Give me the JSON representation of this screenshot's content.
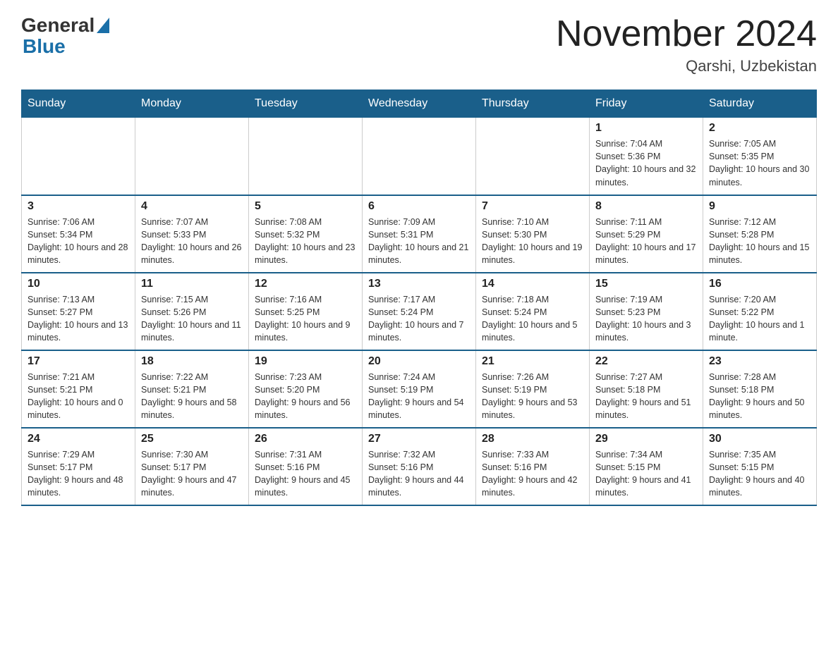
{
  "header": {
    "logo_general": "General",
    "logo_blue": "Blue",
    "title": "November 2024",
    "subtitle": "Qarshi, Uzbekistan"
  },
  "days_of_week": [
    "Sunday",
    "Monday",
    "Tuesday",
    "Wednesday",
    "Thursday",
    "Friday",
    "Saturday"
  ],
  "weeks": [
    [
      {
        "day": "",
        "info": ""
      },
      {
        "day": "",
        "info": ""
      },
      {
        "day": "",
        "info": ""
      },
      {
        "day": "",
        "info": ""
      },
      {
        "day": "",
        "info": ""
      },
      {
        "day": "1",
        "info": "Sunrise: 7:04 AM\nSunset: 5:36 PM\nDaylight: 10 hours and 32 minutes."
      },
      {
        "day": "2",
        "info": "Sunrise: 7:05 AM\nSunset: 5:35 PM\nDaylight: 10 hours and 30 minutes."
      }
    ],
    [
      {
        "day": "3",
        "info": "Sunrise: 7:06 AM\nSunset: 5:34 PM\nDaylight: 10 hours and 28 minutes."
      },
      {
        "day": "4",
        "info": "Sunrise: 7:07 AM\nSunset: 5:33 PM\nDaylight: 10 hours and 26 minutes."
      },
      {
        "day": "5",
        "info": "Sunrise: 7:08 AM\nSunset: 5:32 PM\nDaylight: 10 hours and 23 minutes."
      },
      {
        "day": "6",
        "info": "Sunrise: 7:09 AM\nSunset: 5:31 PM\nDaylight: 10 hours and 21 minutes."
      },
      {
        "day": "7",
        "info": "Sunrise: 7:10 AM\nSunset: 5:30 PM\nDaylight: 10 hours and 19 minutes."
      },
      {
        "day": "8",
        "info": "Sunrise: 7:11 AM\nSunset: 5:29 PM\nDaylight: 10 hours and 17 minutes."
      },
      {
        "day": "9",
        "info": "Sunrise: 7:12 AM\nSunset: 5:28 PM\nDaylight: 10 hours and 15 minutes."
      }
    ],
    [
      {
        "day": "10",
        "info": "Sunrise: 7:13 AM\nSunset: 5:27 PM\nDaylight: 10 hours and 13 minutes."
      },
      {
        "day": "11",
        "info": "Sunrise: 7:15 AM\nSunset: 5:26 PM\nDaylight: 10 hours and 11 minutes."
      },
      {
        "day": "12",
        "info": "Sunrise: 7:16 AM\nSunset: 5:25 PM\nDaylight: 10 hours and 9 minutes."
      },
      {
        "day": "13",
        "info": "Sunrise: 7:17 AM\nSunset: 5:24 PM\nDaylight: 10 hours and 7 minutes."
      },
      {
        "day": "14",
        "info": "Sunrise: 7:18 AM\nSunset: 5:24 PM\nDaylight: 10 hours and 5 minutes."
      },
      {
        "day": "15",
        "info": "Sunrise: 7:19 AM\nSunset: 5:23 PM\nDaylight: 10 hours and 3 minutes."
      },
      {
        "day": "16",
        "info": "Sunrise: 7:20 AM\nSunset: 5:22 PM\nDaylight: 10 hours and 1 minute."
      }
    ],
    [
      {
        "day": "17",
        "info": "Sunrise: 7:21 AM\nSunset: 5:21 PM\nDaylight: 10 hours and 0 minutes."
      },
      {
        "day": "18",
        "info": "Sunrise: 7:22 AM\nSunset: 5:21 PM\nDaylight: 9 hours and 58 minutes."
      },
      {
        "day": "19",
        "info": "Sunrise: 7:23 AM\nSunset: 5:20 PM\nDaylight: 9 hours and 56 minutes."
      },
      {
        "day": "20",
        "info": "Sunrise: 7:24 AM\nSunset: 5:19 PM\nDaylight: 9 hours and 54 minutes."
      },
      {
        "day": "21",
        "info": "Sunrise: 7:26 AM\nSunset: 5:19 PM\nDaylight: 9 hours and 53 minutes."
      },
      {
        "day": "22",
        "info": "Sunrise: 7:27 AM\nSunset: 5:18 PM\nDaylight: 9 hours and 51 minutes."
      },
      {
        "day": "23",
        "info": "Sunrise: 7:28 AM\nSunset: 5:18 PM\nDaylight: 9 hours and 50 minutes."
      }
    ],
    [
      {
        "day": "24",
        "info": "Sunrise: 7:29 AM\nSunset: 5:17 PM\nDaylight: 9 hours and 48 minutes."
      },
      {
        "day": "25",
        "info": "Sunrise: 7:30 AM\nSunset: 5:17 PM\nDaylight: 9 hours and 47 minutes."
      },
      {
        "day": "26",
        "info": "Sunrise: 7:31 AM\nSunset: 5:16 PM\nDaylight: 9 hours and 45 minutes."
      },
      {
        "day": "27",
        "info": "Sunrise: 7:32 AM\nSunset: 5:16 PM\nDaylight: 9 hours and 44 minutes."
      },
      {
        "day": "28",
        "info": "Sunrise: 7:33 AM\nSunset: 5:16 PM\nDaylight: 9 hours and 42 minutes."
      },
      {
        "day": "29",
        "info": "Sunrise: 7:34 AM\nSunset: 5:15 PM\nDaylight: 9 hours and 41 minutes."
      },
      {
        "day": "30",
        "info": "Sunrise: 7:35 AM\nSunset: 5:15 PM\nDaylight: 9 hours and 40 minutes."
      }
    ]
  ]
}
